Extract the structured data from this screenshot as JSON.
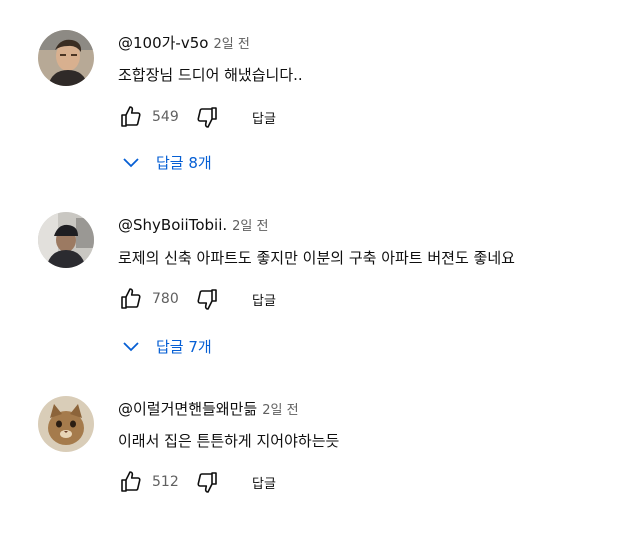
{
  "comments": [
    {
      "handle": "@100가-v5o",
      "time": "2일 전",
      "text": "조합장님 드디어 해냈습니다..",
      "likes": "549",
      "reply_label": "답글",
      "replies_label": "답글 8개",
      "avatar_icon": "person-photo-avatar"
    },
    {
      "handle": "@ShyBoiiTobii.",
      "time": "2일 전",
      "text": "로제의 신축 아파트도 좋지만 이분의 구축 아파트 버젼도 좋네요",
      "likes": "780",
      "reply_label": "답글",
      "replies_label": "답글 7개",
      "avatar_icon": "person-photo-avatar"
    },
    {
      "handle": "@이럴거면핸들왜만듦",
      "time": "2일 전",
      "text": "이래서 집은 튼튼하게 지어야하는듯",
      "likes": "512",
      "reply_label": "답글",
      "avatar_icon": "cat-photo-avatar"
    }
  ],
  "colors": {
    "link_blue": "#065fd4",
    "secondary_text": "#606060"
  }
}
